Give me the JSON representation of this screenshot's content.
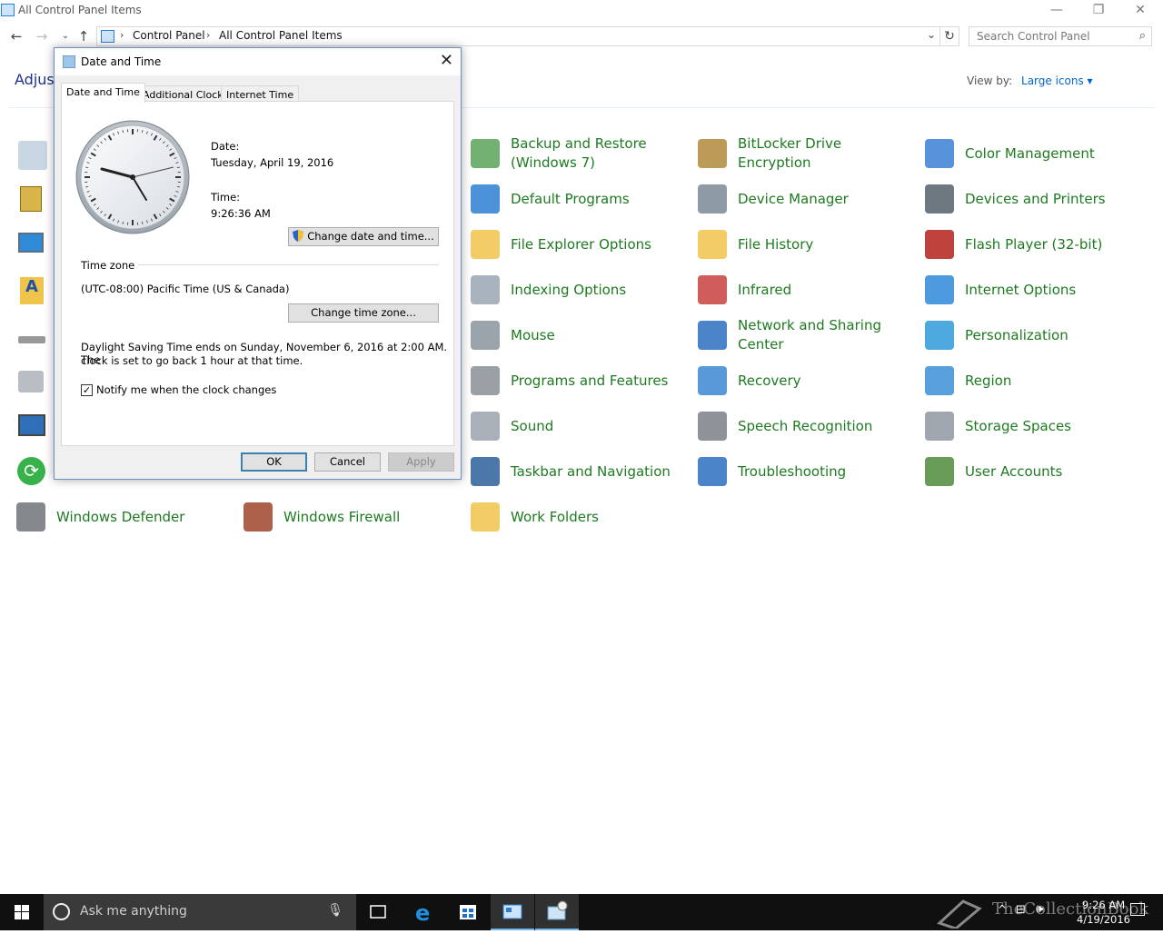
{
  "window": {
    "title": "All Control Panel Items"
  },
  "address": {
    "crumbs": [
      "Control Panel",
      "All Control Panel Items"
    ],
    "search_placeholder": "Search Control Panel"
  },
  "main": {
    "heading_partial": "Adjust",
    "view_by_label": "View by:",
    "view_by_value": "Large icons ▾"
  },
  "items": [
    {
      "label": "Backup and Restore\n(Windows 7)",
      "icon": "backup-icon"
    },
    {
      "label": "BitLocker Drive Encryption",
      "icon": "bitlocker-icon"
    },
    {
      "label": "Color Management",
      "icon": "color-management-icon"
    },
    {
      "label": "Default Programs",
      "icon": "default-programs-icon"
    },
    {
      "label": "Device Manager",
      "icon": "device-manager-icon"
    },
    {
      "label": "Devices and Printers",
      "icon": "printer-icon"
    },
    {
      "label": "File Explorer Options",
      "icon": "folder-options-icon"
    },
    {
      "label": "File History",
      "icon": "file-history-icon"
    },
    {
      "label": "Flash Player (32-bit)",
      "icon": "flash-icon"
    },
    {
      "label": "Indexing Options",
      "icon": "indexing-icon"
    },
    {
      "label": "Infrared",
      "icon": "infrared-icon"
    },
    {
      "label": "Internet Options",
      "icon": "internet-options-icon"
    },
    {
      "label": "Mouse",
      "icon": "mouse-icon"
    },
    {
      "label": "Network and Sharing\nCenter",
      "icon": "network-icon"
    },
    {
      "label": "Personalization",
      "icon": "personalization-icon"
    },
    {
      "label": "Programs and Features",
      "icon": "programs-icon"
    },
    {
      "label": "Recovery",
      "icon": "recovery-icon"
    },
    {
      "label": "Region",
      "icon": "region-icon"
    },
    {
      "label": "Sound",
      "icon": "sound-icon"
    },
    {
      "label": "Speech Recognition",
      "icon": "microphone-icon"
    },
    {
      "label": "Storage Spaces",
      "icon": "storage-icon"
    },
    {
      "label": "Taskbar and Navigation",
      "icon": "taskbar-icon"
    },
    {
      "label": "Troubleshooting",
      "icon": "troubleshooting-icon"
    },
    {
      "label": "User Accounts",
      "icon": "user-accounts-icon"
    },
    {
      "label": "Windows Defender",
      "icon": "defender-icon"
    },
    {
      "label": "Windows Firewall",
      "icon": "firewall-icon"
    },
    {
      "label": "Work Folders",
      "icon": "work-folders-icon"
    }
  ],
  "dialog": {
    "title": "Date and Time",
    "tabs": [
      "Date and Time",
      "Additional Clocks",
      "Internet Time"
    ],
    "date_label": "Date:",
    "date_value": "Tuesday, April 19, 2016",
    "time_label": "Time:",
    "time_value": "9:26:36 AM",
    "change_datetime": "Change date and time...",
    "timezone_label": "Time zone",
    "timezone_value": "(UTC-08:00) Pacific Time (US & Canada)",
    "change_timezone": "Change time zone...",
    "dst_line1": "Daylight Saving Time ends on Sunday, November 6, 2016 at 2:00 AM. The",
    "dst_line2": "clock is set to go back 1 hour at that time.",
    "notify_label": "Notify me when the clock changes",
    "notify_checked": "✓",
    "ok": "OK",
    "cancel": "Cancel",
    "apply": "Apply"
  },
  "taskbar": {
    "search_placeholder": "Ask me anything",
    "time": "9:26 AM",
    "date": "4/19/2016"
  }
}
